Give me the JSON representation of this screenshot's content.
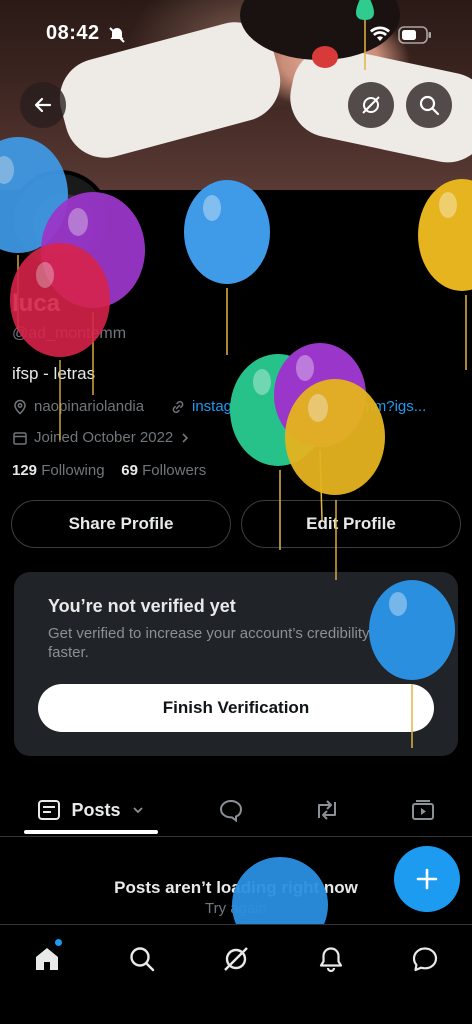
{
  "status_bar": {
    "time": "08:42"
  },
  "profile": {
    "name": "luca",
    "handle": "@ad_montemm",
    "bio": "ifsp - letras",
    "location": "naopinariolandia",
    "website": "instagram.com/ad_montemm?igs...",
    "joined": "Joined October 2022",
    "following_count": "129",
    "following_label": "Following",
    "followers_count": "69",
    "followers_label": "Followers"
  },
  "actions": {
    "share": "Share Profile",
    "edit": "Edit Profile"
  },
  "verify_card": {
    "title": "You’re not verified yet",
    "body": "Get verified to increase your account’s credibility and grow faster.",
    "button": "Finish Verification"
  },
  "tabs": {
    "posts": "Posts"
  },
  "empty_state": {
    "title": "Posts aren’t loading right now",
    "retry": "Try again"
  },
  "colors": {
    "accent": "#1d9bf0",
    "background": "#000000",
    "card": "#202327"
  },
  "icons": {
    "back": "arrow-left-icon",
    "grok": "grok-icon",
    "search": "search-icon",
    "location": "location-pin-icon",
    "link": "link-icon",
    "calendar": "calendar-icon"
  }
}
